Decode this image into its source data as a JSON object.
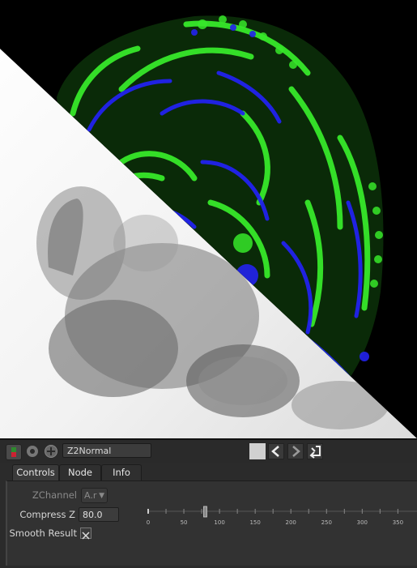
{
  "viewer": {
    "image_description_icon": "viewer-image"
  },
  "toolbar": {
    "node_name": "Z2Normal",
    "icons": [
      "node-toggle-icon",
      "settings-gear-icon",
      "add-circle-icon"
    ],
    "nav_icons": [
      "color-swatch",
      "prev-arrow-icon",
      "next-arrow-icon",
      "return-icon"
    ]
  },
  "tabs": [
    {
      "label": "Controls",
      "active": true
    },
    {
      "label": "Node",
      "active": false
    },
    {
      "label": "Info",
      "active": false
    }
  ],
  "controls": {
    "zchannel_label": "ZChannel",
    "zchannel_value": "A.r",
    "compress_label": "Compress Z",
    "compress_value": "80.0",
    "smooth_label": "Smooth Result",
    "smooth_checked": true,
    "slider": {
      "value": 80,
      "min": 0,
      "max": 370,
      "ticks": [
        "0",
        "50",
        "100",
        "150",
        "200",
        "250",
        "300",
        "350"
      ]
    }
  },
  "colors": {
    "green": "#37e82a",
    "blue": "#2222ee",
    "panel_bg": "#2b2b2b"
  }
}
